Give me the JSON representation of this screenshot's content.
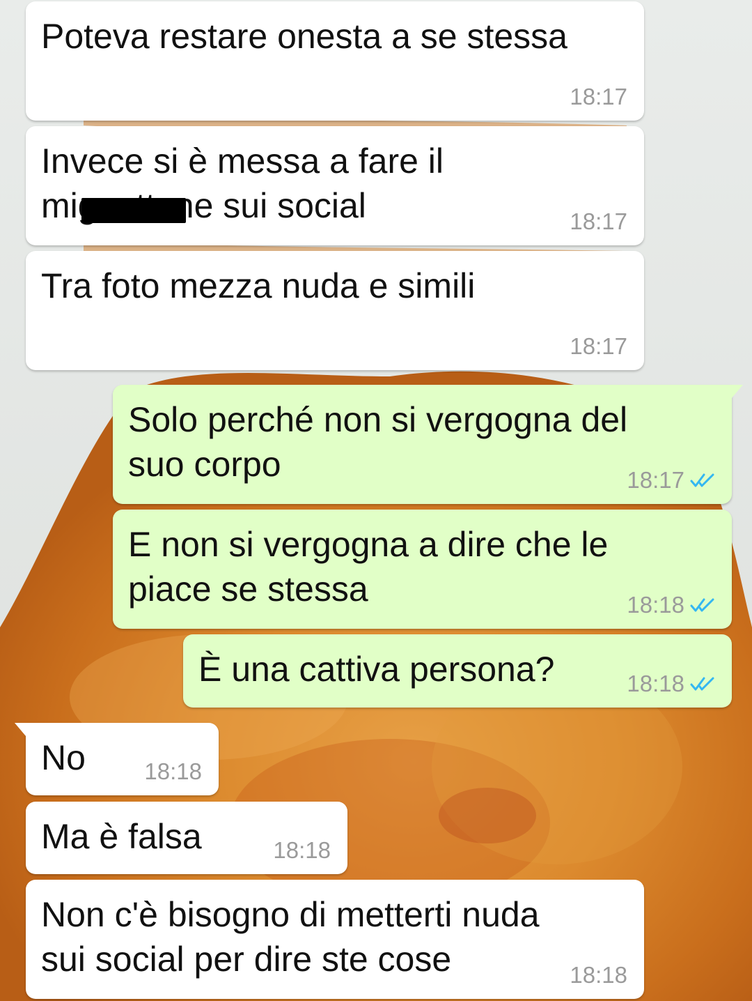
{
  "chat": {
    "messages": [
      {
        "direction": "in",
        "text": "Poteva restare onesta a se stessa",
        "time": "18:17",
        "status": ""
      },
      {
        "direction": "in",
        "text": "Invece si è messa a fare il\nmignottone sui social",
        "time": "18:17",
        "status": "",
        "redacted": true
      },
      {
        "direction": "in",
        "text": "Tra foto mezza nuda e simili",
        "time": "18:17",
        "status": ""
      },
      {
        "direction": "out",
        "text": "Solo perché non si vergogna del\nsuo corpo",
        "time": "18:17",
        "status": "read"
      },
      {
        "direction": "out",
        "text": "E non si vergogna a dire che le\npiace se stessa",
        "time": "18:18",
        "status": "read"
      },
      {
        "direction": "out",
        "text": "È una cattiva persona?",
        "time": "18:18",
        "status": "read"
      },
      {
        "direction": "in",
        "text": "No",
        "time": "18:18",
        "status": ""
      },
      {
        "direction": "in",
        "text": "Ma è falsa",
        "time": "18:18",
        "status": ""
      },
      {
        "direction": "in",
        "text": "Non c'è bisogno di metterti nuda\nsui social per dire ste cose",
        "time": "18:18",
        "status": ""
      }
    ]
  },
  "colors": {
    "incoming_bubble": "#ffffff",
    "outgoing_bubble": "#e1ffc7",
    "read_ticks": "#34b7f1",
    "timestamp": "#9a9a9a",
    "wallpaper": "#d9832b"
  },
  "icons": {
    "read_receipt": "double-check-icon"
  }
}
